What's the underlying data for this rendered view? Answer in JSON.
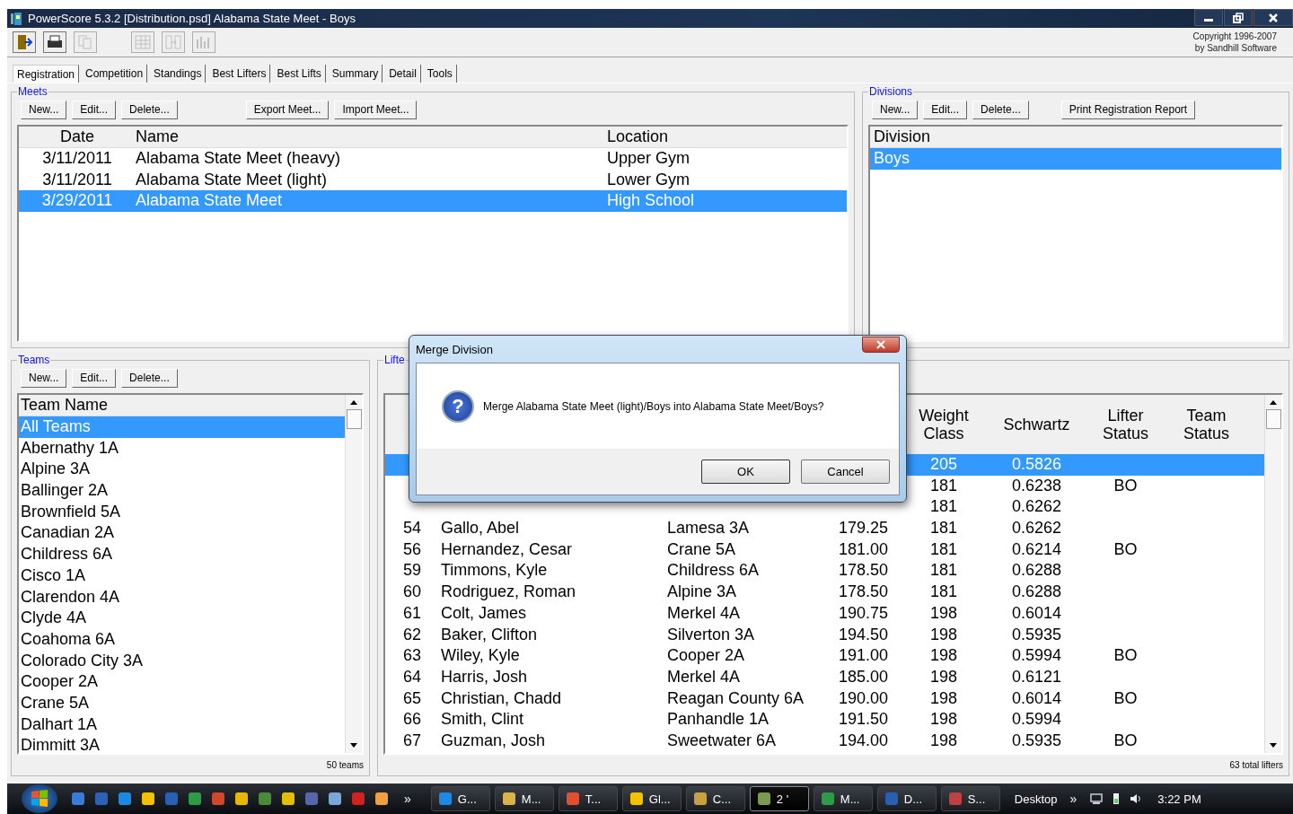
{
  "window": {
    "title": "PowerScore 5.3.2 [Distribution.psd] Alabama State Meet - Boys"
  },
  "toolbar": {
    "buttons": [
      {
        "kind": "exit",
        "disabled": false
      },
      {
        "kind": "print",
        "disabled": false
      },
      {
        "kind": "copy",
        "disabled": true
      },
      {
        "kind": "grid",
        "disabled": true
      },
      {
        "kind": "move",
        "disabled": true
      },
      {
        "kind": "chart",
        "disabled": true
      }
    ],
    "copyright": [
      "Copyright 1996-2007",
      "by Sandhill Software"
    ]
  },
  "tabs": [
    {
      "label": "Registration",
      "selected": true
    },
    {
      "label": "Competition",
      "selected": false
    },
    {
      "label": "Standings",
      "selected": false
    },
    {
      "label": "Best Lifters",
      "selected": false
    },
    {
      "label": "Best Lifts",
      "selected": false
    },
    {
      "label": "Summary",
      "selected": false
    },
    {
      "label": "Detail",
      "selected": false
    },
    {
      "label": "Tools",
      "selected": false
    }
  ],
  "meets": {
    "title": "Meets",
    "buttons": [
      "New...",
      "Edit...",
      "Delete..."
    ],
    "extra_buttons": [
      "Export Meet...",
      "Import Meet..."
    ],
    "columns": [
      "Date",
      "Name",
      "Location"
    ],
    "rows": [
      {
        "date": "3/11/2011",
        "name": "Alabama State Meet (heavy)",
        "location": "Upper Gym",
        "selected": false
      },
      {
        "date": "3/11/2011",
        "name": "Alabama State Meet (light)",
        "location": "Lower Gym",
        "selected": false
      },
      {
        "date": "3/29/2011",
        "name": "Alabama State Meet",
        "location": "High School",
        "selected": true
      }
    ]
  },
  "divisions": {
    "title": "Divisions",
    "buttons": [
      "New...",
      "Edit...",
      "Delete..."
    ],
    "extra_buttons": [
      "Print Registration Report"
    ],
    "columns": [
      "Division"
    ],
    "rows": [
      {
        "name": "Boys",
        "selected": true
      }
    ]
  },
  "teams": {
    "title": "Teams",
    "buttons": [
      "New...",
      "Edit...",
      "Delete..."
    ],
    "column": "Team Name",
    "rows": [
      {
        "name": "All Teams",
        "selected": true
      },
      {
        "name": "Abernathy 1A",
        "selected": false
      },
      {
        "name": "Alpine 3A",
        "selected": false
      },
      {
        "name": "Ballinger 2A",
        "selected": false
      },
      {
        "name": "Brownfield 5A",
        "selected": false
      },
      {
        "name": "Canadian 2A",
        "selected": false
      },
      {
        "name": "Childress 6A",
        "selected": false
      },
      {
        "name": "Cisco 1A",
        "selected": false
      },
      {
        "name": "Clarendon 4A",
        "selected": false
      },
      {
        "name": "Clyde 4A",
        "selected": false
      },
      {
        "name": "Coahoma 6A",
        "selected": false
      },
      {
        "name": "Colorado City 3A",
        "selected": false
      },
      {
        "name": "Cooper 2A",
        "selected": false
      },
      {
        "name": "Crane 5A",
        "selected": false
      },
      {
        "name": "Dalhart 1A",
        "selected": false
      },
      {
        "name": "Dimmitt 3A",
        "selected": false
      }
    ],
    "footer": "50 teams"
  },
  "lifters": {
    "title": "Lifte",
    "columns": {
      "weight_class": "Weight Class",
      "schwartz": "Schwartz",
      "lifter_status": "Lifter Status",
      "team_status": "Team Status"
    },
    "rows": [
      {
        "weight_class": "205",
        "schwartz": "0.5826",
        "selected": true
      },
      {
        "weight_class": "181",
        "schwartz": "0.6238",
        "lifter_status": "BO",
        "selected": false
      },
      {
        "weight_class": "181",
        "schwartz": "0.6262",
        "selected": false
      },
      {
        "no": "54",
        "name": "Gallo, Abel",
        "team": "Lamesa 3A",
        "bodyweight": "179.25",
        "weight_class": "181",
        "schwartz": "0.6262",
        "selected": false
      },
      {
        "no": "56",
        "name": "Hernandez, Cesar",
        "team": "Crane 5A",
        "bodyweight": "181.00",
        "weight_class": "181",
        "schwartz": "0.6214",
        "lifter_status": "BO",
        "selected": false
      },
      {
        "no": "59",
        "name": "Timmons, Kyle",
        "team": "Childress 6A",
        "bodyweight": "178.50",
        "weight_class": "181",
        "schwartz": "0.6288",
        "selected": false
      },
      {
        "no": "60",
        "name": "Rodriguez, Roman",
        "team": "Alpine 3A",
        "bodyweight": "178.50",
        "weight_class": "181",
        "schwartz": "0.6288",
        "selected": false
      },
      {
        "no": "61",
        "name": "Colt, James",
        "team": "Merkel 4A",
        "bodyweight": "190.75",
        "weight_class": "198",
        "schwartz": "0.6014",
        "selected": false
      },
      {
        "no": "62",
        "name": "Baker, Clifton",
        "team": "Silverton 3A",
        "bodyweight": "194.50",
        "weight_class": "198",
        "schwartz": "0.5935",
        "selected": false
      },
      {
        "no": "63",
        "name": "Wiley, Kyle",
        "team": "Cooper 2A",
        "bodyweight": "191.00",
        "weight_class": "198",
        "schwartz": "0.5994",
        "lifter_status": "BO",
        "selected": false
      },
      {
        "no": "64",
        "name": "Harris, Josh",
        "team": "Merkel 4A",
        "bodyweight": "185.00",
        "weight_class": "198",
        "schwartz": "0.6121",
        "selected": false
      },
      {
        "no": "65",
        "name": "Christian, Chadd",
        "team": "Reagan County 6A",
        "bodyweight": "190.00",
        "weight_class": "198",
        "schwartz": "0.6014",
        "lifter_status": "BO",
        "selected": false
      },
      {
        "no": "66",
        "name": "Smith, Clint",
        "team": "Panhandle 1A",
        "bodyweight": "191.50",
        "weight_class": "198",
        "schwartz": "0.5994",
        "selected": false
      },
      {
        "no": "67",
        "name": "Guzman, Josh",
        "team": "Sweetwater 6A",
        "bodyweight": "194.00",
        "weight_class": "198",
        "schwartz": "0.5935",
        "lifter_status": "BO",
        "selected": false
      }
    ],
    "footer": "63 total lifters"
  },
  "dialog": {
    "title": "Merge Division",
    "icon_glyph": "?",
    "message": "Merge Alabama State Meet (light)/Boys into Alabama State Meet/Boys?",
    "buttons": [
      "OK",
      "Cancel"
    ]
  },
  "taskbar": {
    "quick_launch_more": "»",
    "tasks": [
      {
        "label": "G...",
        "selected": false
      },
      {
        "label": "M...",
        "selected": false
      },
      {
        "label": "T...",
        "selected": false
      },
      {
        "label": "Gl...",
        "selected": false
      },
      {
        "label": "C...",
        "selected": false
      },
      {
        "label": "2 '",
        "selected": true
      },
      {
        "label": "M...",
        "selected": false
      },
      {
        "label": "D...",
        "selected": false
      },
      {
        "label": "S...",
        "selected": false
      }
    ],
    "toolbar_label": "Desktop",
    "toolbar_more": "»",
    "clock": "3:22 PM"
  }
}
